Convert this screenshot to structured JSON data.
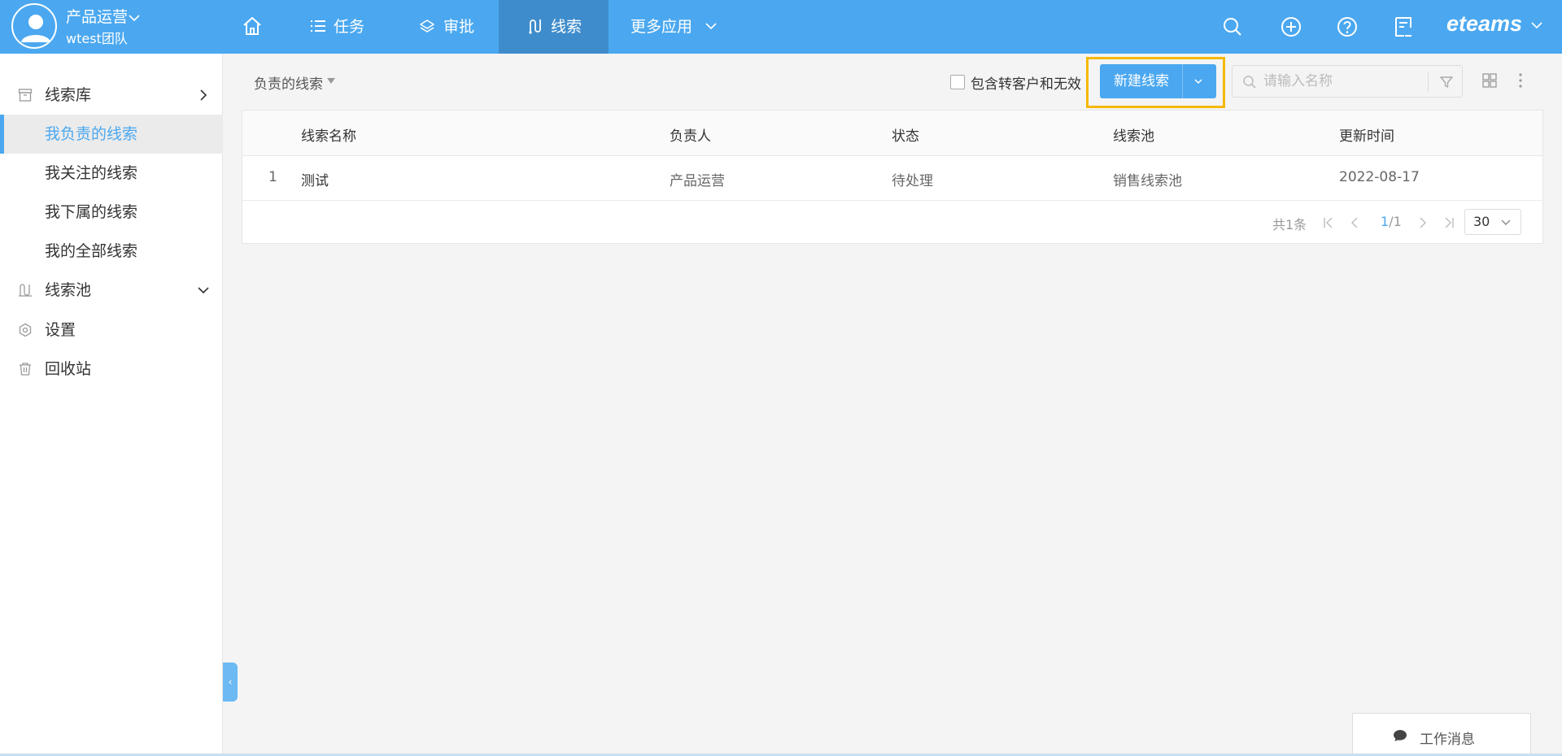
{
  "header": {
    "user_name": "产品运营",
    "team_name": "wtest团队",
    "nav": [
      {
        "label": "",
        "icon": "home-icon"
      },
      {
        "label": "任务",
        "icon": "list-icon"
      },
      {
        "label": "审批",
        "icon": "layers-icon"
      },
      {
        "label": "线索",
        "icon": "clue-icon",
        "active": true
      },
      {
        "label": "更多应用",
        "icon": "chevron-down-icon"
      }
    ],
    "right_icons": [
      "search-icon",
      "plus-circle-icon",
      "help-icon",
      "notes-icon"
    ],
    "brand": "eteams"
  },
  "sidebar": {
    "items": [
      {
        "label": "线索库",
        "icon": "box-icon",
        "arrow": "chevron-right-icon"
      },
      {
        "label": "我负责的线索",
        "active": true
      },
      {
        "label": "我关注的线索"
      },
      {
        "label": "我下属的线索"
      },
      {
        "label": "我的全部线索"
      },
      {
        "label": "线索池",
        "icon": "pool-icon",
        "arrow": "chevron-down-icon"
      },
      {
        "label": "设置",
        "icon": "hexagon-settings-icon"
      },
      {
        "label": "回收站",
        "icon": "trash-icon"
      }
    ],
    "collapse_label": "‹"
  },
  "toolbar": {
    "filter_label": "负责的线索",
    "checkbox_label": "包含转客户和无效",
    "checkbox_checked": false,
    "new_button_label": "新建线索",
    "search_placeholder": "请输入名称",
    "search_value": ""
  },
  "table": {
    "columns": [
      "线索名称",
      "负责人",
      "状态",
      "线索池",
      "更新时间"
    ],
    "rows": [
      {
        "index": "1",
        "name": "测试",
        "owner": "产品运营",
        "status": "待处理",
        "pool": "销售线索池",
        "updated": "2022-08-17"
      }
    ],
    "pagination": {
      "total_text": "共1条",
      "current_page": "1",
      "total_pages": "/1",
      "page_size": "30"
    }
  },
  "work_message": {
    "label": "工作消息"
  },
  "colors": {
    "primary": "#4ba8f0",
    "nav_active": "#3f8ccc",
    "highlight": "#f5b800"
  }
}
